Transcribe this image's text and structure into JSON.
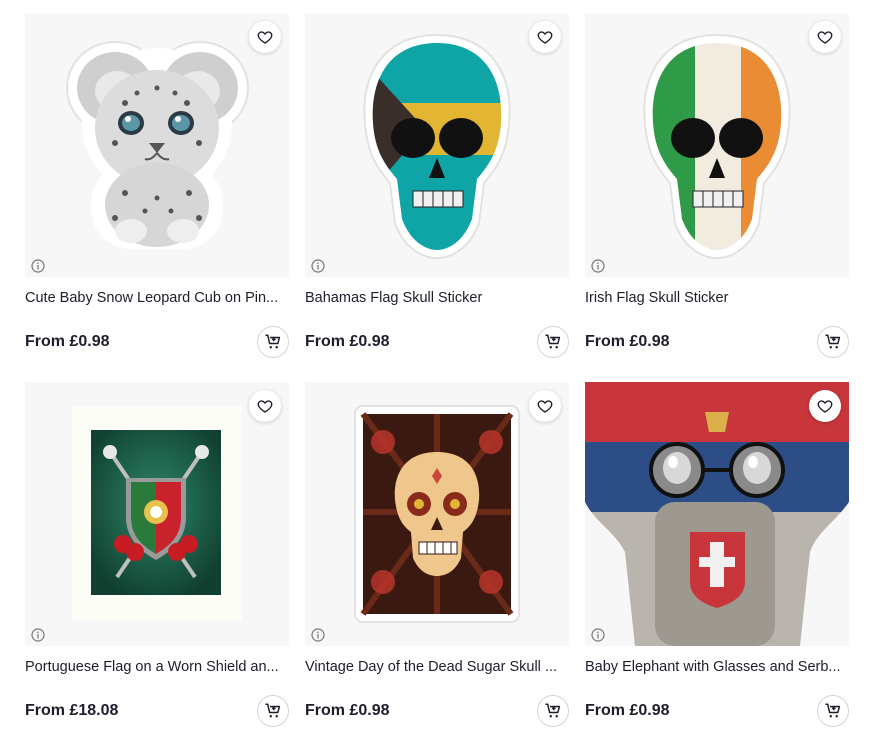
{
  "products": [
    {
      "title": "Cute Baby Snow Leopard Cub on Pin...",
      "price": "From £0.98",
      "image": "snow-leopard-cub-sticker"
    },
    {
      "title": "Bahamas Flag Skull Sticker",
      "price": "From £0.98",
      "image": "bahamas-flag-skull-sticker"
    },
    {
      "title": "Irish Flag Skull Sticker",
      "price": "From £0.98",
      "image": "irish-flag-skull-sticker"
    },
    {
      "title": "Portuguese Flag on a Worn Shield an...",
      "price": "From £18.08",
      "image": "portuguese-flag-shield-art-print"
    },
    {
      "title": "Vintage Day of the Dead Sugar Skull ...",
      "price": "From £0.98",
      "image": "sugar-skull-sticker"
    },
    {
      "title": "Baby Elephant with Glasses and Serb...",
      "price": "From £0.98",
      "image": "serbian-flag-elephant-sticker"
    }
  ],
  "icons": {
    "favorite": "heart-icon",
    "cart": "add-to-cart-icon",
    "info": "info-icon"
  },
  "colors": {
    "thumb_background": "#f7f7f7",
    "text": "#1f1d2b",
    "bahamas_aqua": "#0fa5a6",
    "bahamas_gold": "#e2b632",
    "irish_green": "#2f9a48",
    "irish_orange": "#e98c33",
    "portugal_green": "#1f6b4f",
    "portugal_red": "#c8232c",
    "serbia_red": "#c8363b",
    "serbia_blue": "#2d4d86"
  }
}
